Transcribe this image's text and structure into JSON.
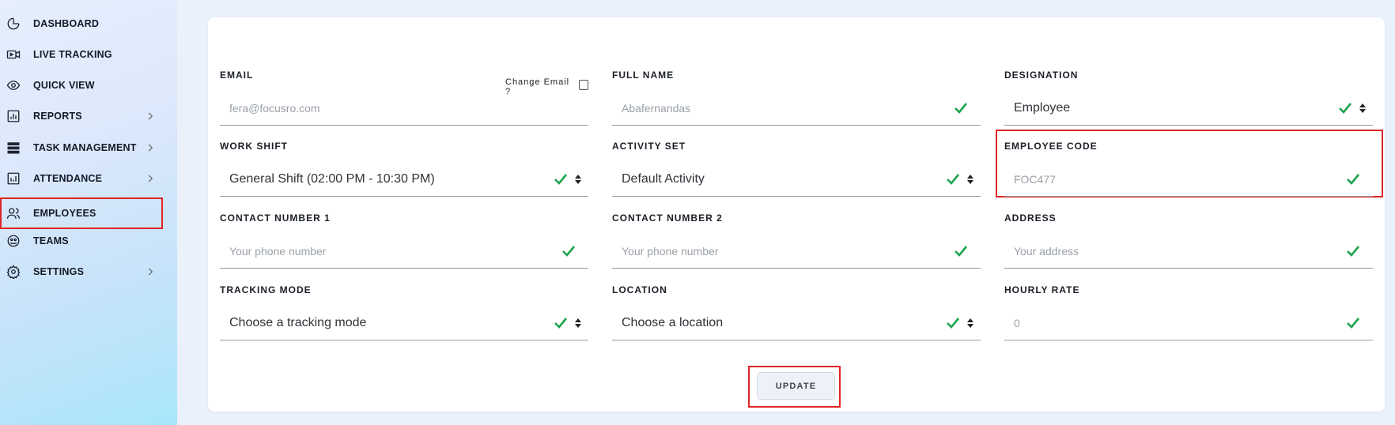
{
  "sidebar": {
    "items": [
      {
        "label": "DASHBOARD",
        "icon": "pie-chart-icon"
      },
      {
        "label": "LIVE TRACKING",
        "icon": "video-icon"
      },
      {
        "label": "QUICK VIEW",
        "icon": "eye-icon"
      },
      {
        "label": "REPORTS",
        "icon": "report-chart-icon"
      },
      {
        "label": "TASK MANAGEMENT",
        "icon": "server-stack-icon"
      },
      {
        "label": "ATTENDANCE",
        "icon": "attendance-chart-icon"
      },
      {
        "label": "EMPLOYEES",
        "icon": "users-icon"
      },
      {
        "label": "TEAMS",
        "icon": "team-smile-icon"
      },
      {
        "label": "SETTINGS",
        "icon": "gear-icon"
      }
    ]
  },
  "form": {
    "email": {
      "label": "EMAIL",
      "placeholder": "fera@focusro.com",
      "change_label": "Change Email ?"
    },
    "full_name": {
      "label": "FULL NAME",
      "placeholder": "Abafernandas"
    },
    "designation": {
      "label": "DESIGNATION",
      "value": "Employee"
    },
    "work_shift": {
      "label": "WORK SHIFT",
      "value": "General Shift (02:00 PM - 10:30 PM)"
    },
    "activity_set": {
      "label": "ACTIVITY SET",
      "value": "Default Activity"
    },
    "employee_code": {
      "label": "EMPLOYEE CODE",
      "placeholder": "FOC477"
    },
    "contact_1": {
      "label": "CONTACT NUMBER 1",
      "placeholder": "Your phone number"
    },
    "contact_2": {
      "label": "CONTACT NUMBER 2",
      "placeholder": "Your phone number"
    },
    "address": {
      "label": "ADDRESS",
      "placeholder": "Your address"
    },
    "tracking_mode": {
      "label": "TRACKING MODE",
      "value": "Choose a tracking mode"
    },
    "location": {
      "label": "LOCATION",
      "value": "Choose a location"
    },
    "hourly_rate": {
      "label": "HOURLY RATE",
      "placeholder": "0"
    },
    "update_label": "UPDATE"
  },
  "colors": {
    "check": "#1aa34a",
    "highlight": "#e02424"
  }
}
